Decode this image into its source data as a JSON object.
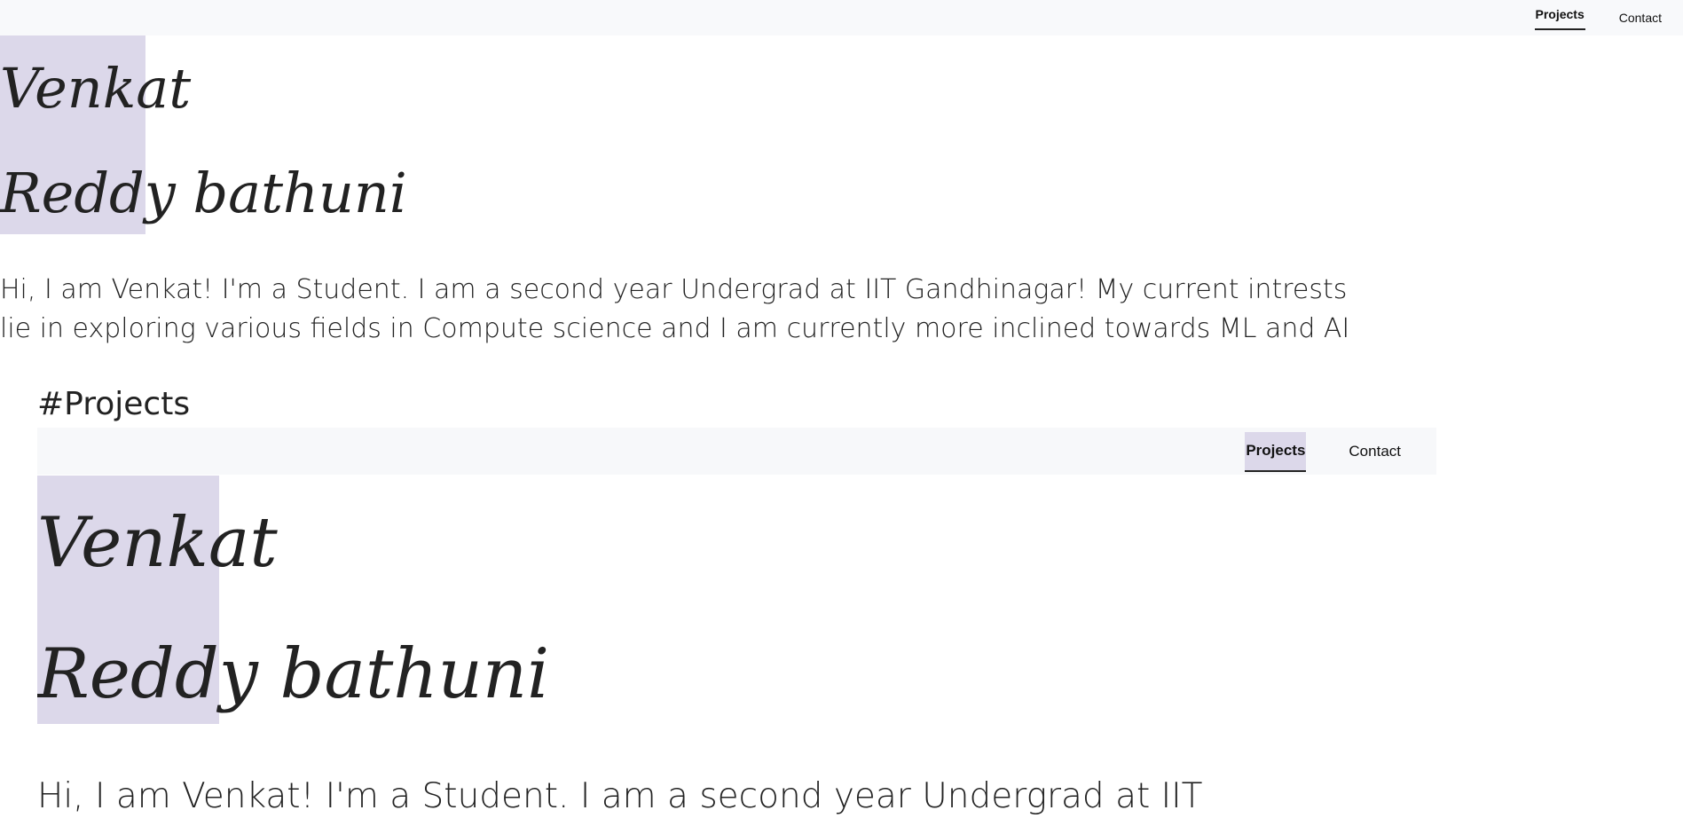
{
  "nav": {
    "projects_label": "Projects",
    "contact_label": "Contact"
  },
  "hero": {
    "name_line1": "Venkat",
    "name_line2": "Reddy bathuni",
    "intro": "Hi, I am Venkat! I'm a Student. I am a second year Undergrad at IIT Gandhinagar! My current intrests lie in exploring various fields in Compute science and I am currently more inclined towards ML and AI"
  },
  "projects": {
    "heading": "#Projects"
  },
  "embedded_preview": {
    "projects_label": "Projects",
    "contact_label": "Contact",
    "name_line1": "Venkat",
    "name_line2": "Reddy bathuni",
    "intro_partial": "Hi, I am Venkat! I'm a Student. I am a second year Undergrad at IIT"
  },
  "colors": {
    "highlight": "#dcd8ea",
    "navbar_bg": "#f8f9fb",
    "text": "#222222"
  }
}
